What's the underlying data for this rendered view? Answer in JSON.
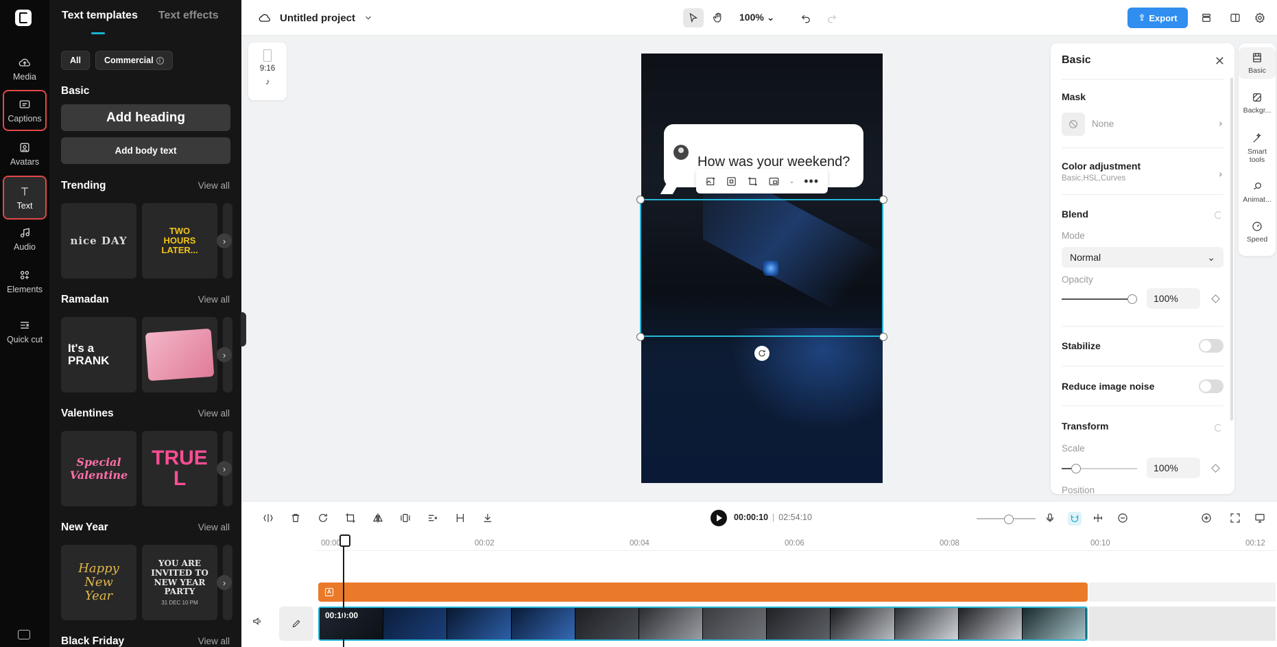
{
  "rail": {
    "items": [
      {
        "label": "Media"
      },
      {
        "label": "Captions"
      },
      {
        "label": "Avatars"
      },
      {
        "label": "Text"
      },
      {
        "label": "Audio"
      },
      {
        "label": "Elements"
      },
      {
        "label": "Quick cut"
      }
    ]
  },
  "panel": {
    "tabs": [
      "Text templates",
      "Text effects"
    ],
    "filters": [
      "All",
      "Commercial"
    ],
    "basic_title": "Basic",
    "add_heading": "Add heading",
    "add_body": "Add body text",
    "view_all": "View all",
    "sections": [
      {
        "title": "Trending",
        "cards": [
          "nice DAY",
          "TWO HOURS LATER..."
        ]
      },
      {
        "title": "Ramadan",
        "cards": [
          "It's a PRANK",
          ""
        ]
      },
      {
        "title": "Valentines",
        "cards": [
          "Special Valentine",
          "TRUE L"
        ]
      },
      {
        "title": "New Year",
        "cards": [
          "Happy New Year",
          "YOU ARE INVITED TO NEW YEAR PARTY"
        ]
      },
      {
        "title": "Black Friday",
        "cards": []
      }
    ]
  },
  "topbar": {
    "project_name": "Untitled project",
    "zoom": "100%",
    "export_label": "Export"
  },
  "canvas": {
    "aspect": "9:16",
    "bubble_text": "How was your weekend?",
    "new_year_date": "31 DEC 10 PM"
  },
  "props": {
    "title": "Basic",
    "mask_label": "Mask",
    "mask_value": "None",
    "color_label": "Color adjustment",
    "color_sub": "Basic,HSL,Curves",
    "blend_label": "Blend",
    "mode_label": "Mode",
    "mode_value": "Normal",
    "opacity_label": "Opacity",
    "opacity_value": "100%",
    "opacity_fraction": 1.0,
    "stabilize_label": "Stabilize",
    "noise_label": "Reduce image noise",
    "transform_label": "Transform",
    "scale_label": "Scale",
    "scale_value": "100%",
    "position_label": "Position"
  },
  "vtabs": [
    {
      "label": "Basic",
      "icon": "film-icon"
    },
    {
      "label": "Backgr...",
      "icon": "background-icon"
    },
    {
      "label": "Smart tools",
      "icon": "magic-wand-icon"
    },
    {
      "label": "Animat...",
      "icon": "animation-icon"
    },
    {
      "label": "Speed",
      "icon": "speed-icon"
    }
  ],
  "timeline": {
    "current_time": "00:00:10",
    "duration": "02:54:10",
    "ruler": [
      "00:00",
      "00:02",
      "00:04",
      "00:06",
      "00:08",
      "00:10",
      "00:12"
    ],
    "clip_timecode": "00:10:00"
  }
}
